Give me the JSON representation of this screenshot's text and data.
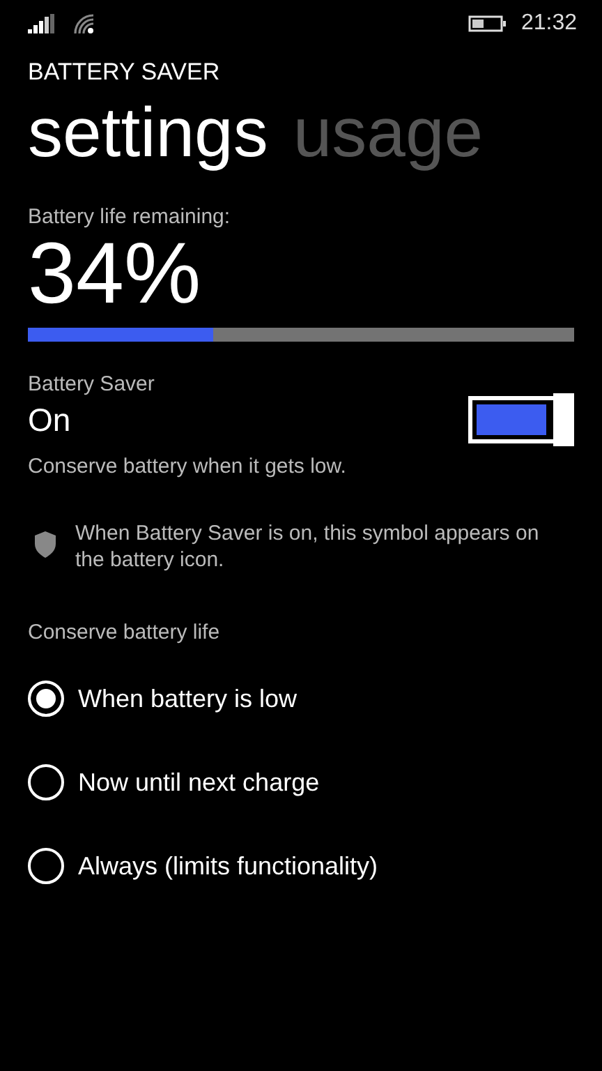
{
  "status_bar": {
    "time": "21:32"
  },
  "app_title": "BATTERY SAVER",
  "pivots": [
    {
      "label": "settings",
      "selected": true
    },
    {
      "label": "usage",
      "selected": false
    }
  ],
  "battery": {
    "label": "Battery life remaining:",
    "percent": "34%",
    "level": 0.34
  },
  "saver": {
    "label": "Battery Saver",
    "state_text": "On",
    "on": true,
    "description": "Conserve battery when it gets low."
  },
  "info": "When Battery Saver is on, this symbol appears on the battery icon.",
  "conserve": {
    "label": "Conserve battery life",
    "options": [
      {
        "label": "When battery is low",
        "selected": true
      },
      {
        "label": "Now until next charge",
        "selected": false
      },
      {
        "label": "Always (limits functionality)",
        "selected": false
      }
    ]
  }
}
